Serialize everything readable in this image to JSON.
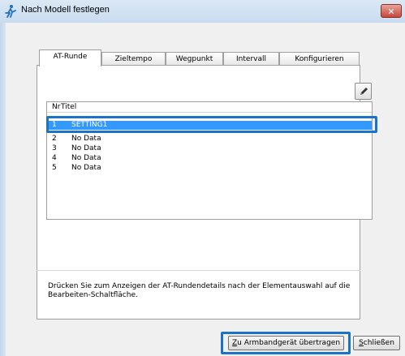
{
  "window": {
    "title": "Nach Modell festlegen",
    "close_glyph": "✕"
  },
  "tabs": [
    {
      "label": "AT-Runde",
      "active": true
    },
    {
      "label": "Zieltempo",
      "active": false
    },
    {
      "label": "Wegpunkt",
      "active": false
    },
    {
      "label": "Intervall",
      "active": false
    },
    {
      "label": "Konfigurieren",
      "active": false
    }
  ],
  "list": {
    "headers": {
      "nr": "Nr",
      "title": "Titel"
    },
    "rows": [
      {
        "nr": "1",
        "title": "SETTING1",
        "selected": true
      },
      {
        "nr": "2",
        "title": "No Data",
        "selected": false
      },
      {
        "nr": "3",
        "title": "No Data",
        "selected": false
      },
      {
        "nr": "4",
        "title": "No Data",
        "selected": false
      },
      {
        "nr": "5",
        "title": "No Data",
        "selected": false
      }
    ]
  },
  "hint_text": "Drücken Sie zum Anzeigen der AT-Rundendetails nach der Elementauswahl auf die Bearbeiten-Schaltfläche.",
  "buttons": {
    "transfer_mnemonic": "Z",
    "transfer_rest": "u Armbandgerät übertragen",
    "close_mnemonic": "S",
    "close_rest": "chließen"
  },
  "icons": {
    "app": "runner-icon",
    "edit": "pencil-icon"
  },
  "colors": {
    "selection": "#3399ff",
    "highlight_frame": "#1a73c8"
  }
}
